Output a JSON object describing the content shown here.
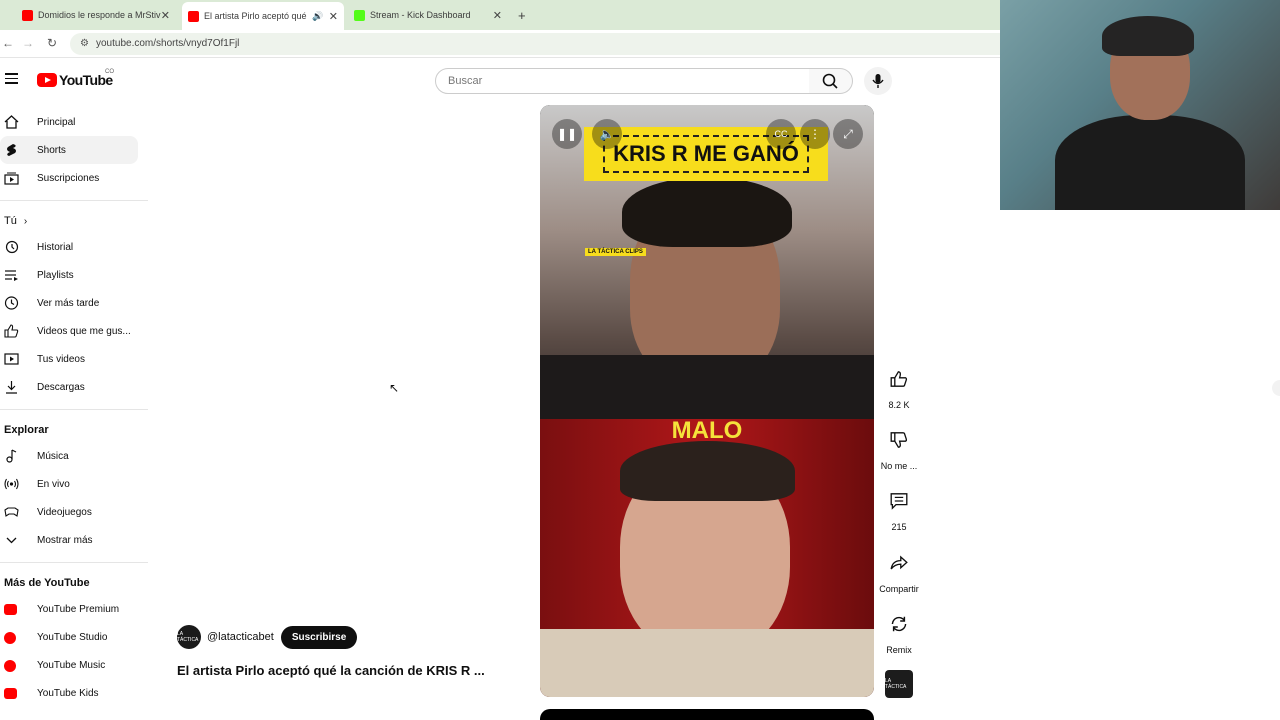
{
  "browser": {
    "tabs": [
      {
        "title": "Domidios le responde a MrStiv",
        "favicon_color": "#ff0000",
        "active": false
      },
      {
        "title": "El artista Pirlo aceptó qué la",
        "favicon_color": "#ff0000",
        "active": true
      },
      {
        "title": "Stream - Kick Dashboard",
        "favicon_color": "#53fc18",
        "active": false
      }
    ],
    "url": "youtube.com/shorts/vnyd7Of1Fjl"
  },
  "header": {
    "logo_text": "YouTube",
    "country_code": "CO",
    "search_placeholder": "Buscar"
  },
  "sidebar": {
    "main": [
      {
        "label": "Principal",
        "icon": "home-icon"
      },
      {
        "label": "Shorts",
        "icon": "shorts-icon",
        "selected": true
      },
      {
        "label": "Suscripciones",
        "icon": "subscriptions-icon"
      }
    ],
    "you_heading": "Tú",
    "you": [
      {
        "label": "Historial",
        "icon": "history-icon"
      },
      {
        "label": "Playlists",
        "icon": "playlists-icon"
      },
      {
        "label": "Ver más tarde",
        "icon": "clock-icon"
      },
      {
        "label": "Videos que me gus...",
        "icon": "like-icon"
      },
      {
        "label": "Tus videos",
        "icon": "your-videos-icon"
      },
      {
        "label": "Descargas",
        "icon": "download-icon"
      }
    ],
    "explore_heading": "Explorar",
    "explore": [
      {
        "label": "Música",
        "icon": "music-icon"
      },
      {
        "label": "En vivo",
        "icon": "live-icon"
      },
      {
        "label": "Videojuegos",
        "icon": "gaming-icon"
      },
      {
        "label": "Mostrar más",
        "icon": "chevron-down-icon"
      }
    ],
    "more_heading": "Más de YouTube",
    "more": [
      {
        "label": "YouTube Premium",
        "icon": "youtube-premium-icon"
      },
      {
        "label": "YouTube Studio",
        "icon": "youtube-studio-icon"
      },
      {
        "label": "YouTube Music",
        "icon": "youtube-music-icon"
      },
      {
        "label": "YouTube Kids",
        "icon": "youtube-kids-icon"
      }
    ]
  },
  "short": {
    "banner_text": "KRIS R ME GANÓ",
    "overlay_clip_tag": "LA TÁCTICA CLIPS",
    "overlay_bottom_text": "MALO",
    "channel_handle": "@latacticabet",
    "subscribe_label": "Suscribirse",
    "title": "El artista Pirlo aceptó qué la canción de KRIS R ...",
    "channel_avatar_text": "LA TÁCTICA"
  },
  "actions": {
    "like_count": "8.2 K",
    "dislike_label": "No me ...",
    "comments_count": "215",
    "share_label": "Compartir",
    "remix_label": "Remix"
  }
}
